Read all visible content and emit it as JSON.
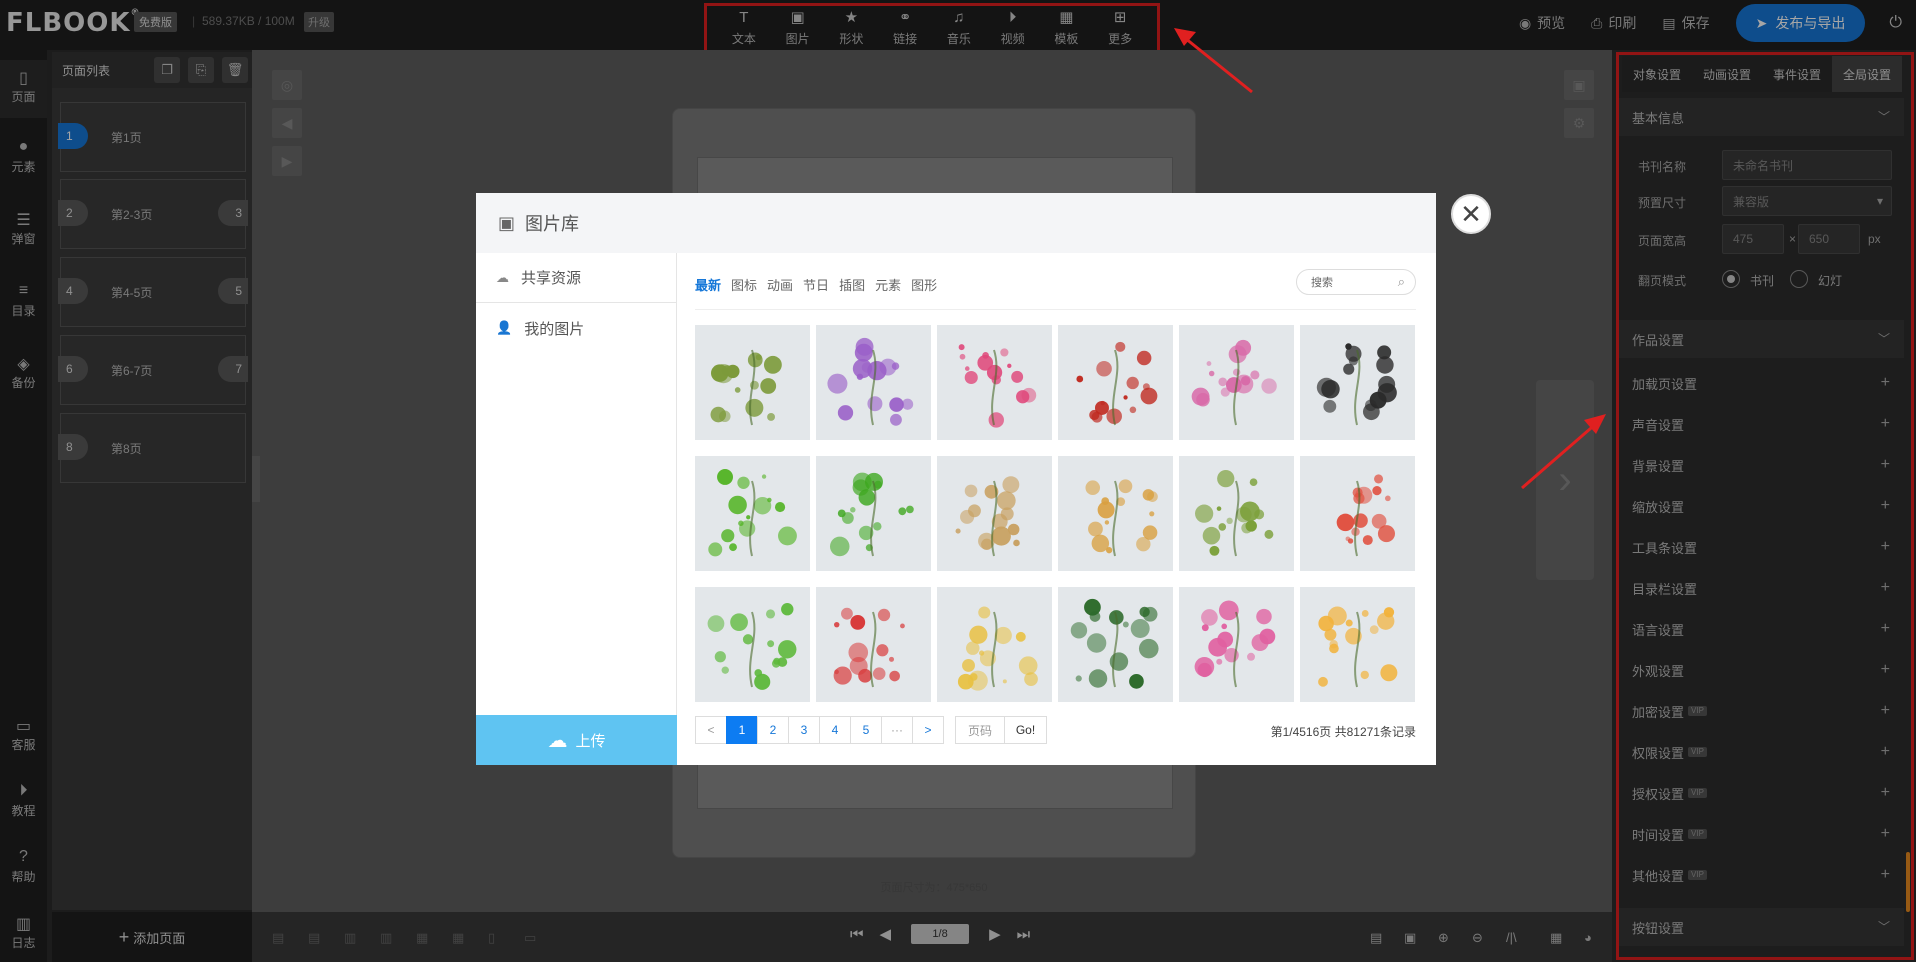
{
  "app": {
    "logo": "FLBOOK",
    "edition_badge": "免费版",
    "storage": "589.37KB / 100M",
    "upgrade_badge": "升级"
  },
  "toolbar": {
    "items": [
      {
        "label": "文本",
        "icon": "text-icon"
      },
      {
        "label": "图片",
        "icon": "image-icon"
      },
      {
        "label": "形状",
        "icon": "star-icon"
      },
      {
        "label": "链接",
        "icon": "link-icon"
      },
      {
        "label": "音乐",
        "icon": "music-icon"
      },
      {
        "label": "视频",
        "icon": "video-icon"
      },
      {
        "label": "模板",
        "icon": "template-icon"
      },
      {
        "label": "更多",
        "icon": "more-icon"
      }
    ]
  },
  "top_actions": {
    "preview": "预览",
    "print": "印刷",
    "save": "保存",
    "publish": "发布与导出"
  },
  "left_nav": {
    "items": [
      {
        "label": "页面",
        "icon": "page-icon"
      },
      {
        "label": "元素",
        "icon": "elements-icon"
      },
      {
        "label": "弹窗",
        "icon": "popup-icon"
      },
      {
        "label": "目录",
        "icon": "list-icon"
      },
      {
        "label": "备份",
        "icon": "layers-icon"
      }
    ],
    "bottom_items": [
      {
        "label": "客服",
        "icon": "chat-icon"
      },
      {
        "label": "教程",
        "icon": "play-icon"
      },
      {
        "label": "帮助",
        "icon": "help-icon"
      },
      {
        "label": "日志",
        "icon": "log-icon"
      }
    ]
  },
  "page_list": {
    "title": "页面列表",
    "pages": [
      {
        "num": "1",
        "num2": "",
        "title": "第1页"
      },
      {
        "num": "2",
        "num2": "3",
        "title": "第2-3页"
      },
      {
        "num": "4",
        "num2": "5",
        "title": "第4-5页"
      },
      {
        "num": "6",
        "num2": "7",
        "title": "第6-7页"
      },
      {
        "num": "8",
        "num2": "",
        "title": "第8页"
      }
    ],
    "add_page": "添加页面"
  },
  "workspace": {
    "page_size_text": "页面尺寸为：475*650"
  },
  "bottom_bar": {
    "page_indicator": "1/8"
  },
  "right_panel": {
    "tabs": [
      "对象设置",
      "动画设置",
      "事件设置",
      "全局设置"
    ],
    "basic_info": {
      "title": "基本信息",
      "book_name_label": "书刊名称",
      "book_name_value": "未命名书刊",
      "preset_size_label": "预置尺寸",
      "preset_size_value": "兼容版",
      "page_wh_label": "页面宽高",
      "width": "475",
      "height": "650",
      "times": "×",
      "unit": "px",
      "flip_mode_label": "翻页模式",
      "flip_option_book": "书刊",
      "flip_option_slide": "幻灯"
    },
    "work_settings_title": "作品设置",
    "settings": [
      {
        "label": "加载页设置",
        "vip": false
      },
      {
        "label": "声音设置",
        "vip": false
      },
      {
        "label": "背景设置",
        "vip": false
      },
      {
        "label": "缩放设置",
        "vip": false
      },
      {
        "label": "工具条设置",
        "vip": false
      },
      {
        "label": "目录栏设置",
        "vip": false
      },
      {
        "label": "语言设置",
        "vip": false
      },
      {
        "label": "外观设置",
        "vip": false
      },
      {
        "label": "加密设置",
        "vip": true
      },
      {
        "label": "权限设置",
        "vip": true
      },
      {
        "label": "授权设置",
        "vip": true
      },
      {
        "label": "时间设置",
        "vip": true
      },
      {
        "label": "其他设置",
        "vip": true
      }
    ],
    "vip_badge": "VIP",
    "button_settings_title": "按钮设置"
  },
  "modal": {
    "title": "图片库",
    "side": {
      "shared": "共享资源",
      "mine": "我的图片",
      "upload": "上传"
    },
    "categories": [
      "最新",
      "图标",
      "动画",
      "节日",
      "插图",
      "元素",
      "图形"
    ],
    "search_placeholder": "搜索",
    "images": [
      {
        "name": "bamboo",
        "color": "#7c9a3a"
      },
      {
        "name": "wisteria",
        "color": "#9a5fc8"
      },
      {
        "name": "pink-blossom-tree",
        "color": "#e0477a"
      },
      {
        "name": "red-plum-branch",
        "color": "#c0281e"
      },
      {
        "name": "peony-branch",
        "color": "#d86aa8"
      },
      {
        "name": "white-plum-branch",
        "color": "#2a2a2a"
      },
      {
        "name": "vine-border",
        "color": "#4fb21f"
      },
      {
        "name": "leaf-sprig",
        "color": "#3ea81f"
      },
      {
        "name": "gold-sparkles",
        "color": "#c8a060"
      },
      {
        "name": "scattered-petals",
        "color": "#d9a040"
      },
      {
        "name": "willow",
        "color": "#7ca03a"
      },
      {
        "name": "falling-petals",
        "color": "#e05040"
      },
      {
        "name": "clover-child",
        "color": "#5cb83a"
      },
      {
        "name": "red-rose",
        "color": "#d83a3a"
      },
      {
        "name": "wildflowers",
        "color": "#e8c040"
      },
      {
        "name": "ink-grass",
        "color": "#2c6a2a"
      },
      {
        "name": "flower-bed",
        "color": "#e060a0"
      },
      {
        "name": "yellow-flowers",
        "color": "#f2b23a"
      }
    ],
    "pagination": {
      "prev": "<",
      "pages": [
        "1",
        "2",
        "3",
        "4",
        "5"
      ],
      "ellipsis": "···",
      "next": ">",
      "goto_placeholder": "页码",
      "go": "Go!",
      "records": "第1/4516页  共81271条记录"
    }
  },
  "colors": {
    "accent": "#1677d8",
    "highlight": "#e02020",
    "upload": "#5fc4f2"
  }
}
